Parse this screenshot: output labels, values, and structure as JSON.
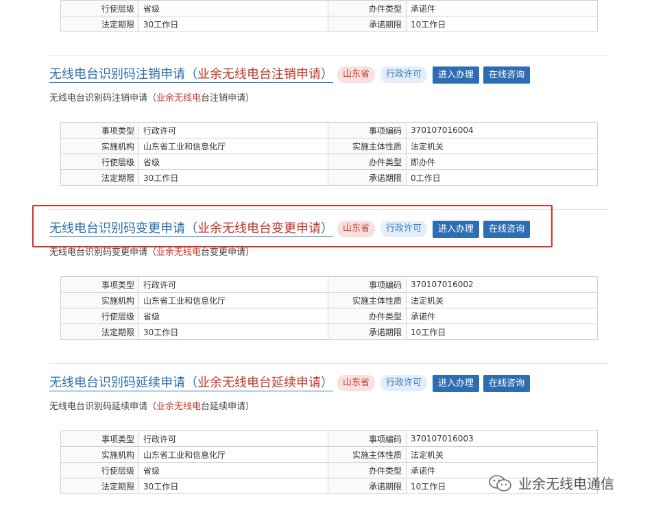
{
  "tags": {
    "region": "山东省",
    "type": "行政许可"
  },
  "buttons": {
    "enter": "进入办理",
    "consult": "在线咨询"
  },
  "labels": {
    "item_type": "事项类型",
    "item_code": "事项编码",
    "agency": "实施机构",
    "subject_nature": "实施主体性质",
    "level": "行使层级",
    "handling_type": "办件类型",
    "legal_deadline": "法定期限",
    "promised_deadline": "承诺期限"
  },
  "top_partial": {
    "level": "省级",
    "handling_type": "承诺件",
    "legal_deadline": "30工作日",
    "promised_deadline": "10工作日"
  },
  "items": [
    {
      "title_main": "无线电台识别码注销申请（",
      "title_hl": "业余无线电台注销申请",
      "title_end": "）",
      "desc_pre": "无线电台识别码注销申请（",
      "desc_hl": "业余无线电",
      "desc_post": "台注销申请）",
      "item_type": "行政许可",
      "item_code": "370107016004",
      "agency": "山东省工业和信息化厅",
      "subject_nature": "法定机关",
      "level": "省级",
      "handling_type": "即办件",
      "legal_deadline": "30工作日",
      "promised_deadline": "0工作日"
    },
    {
      "title_main": "无线电台识别码变更申请（",
      "title_hl": "业余无线电台变更申请",
      "title_end": "）",
      "desc_pre": "无线电台识别码变更申请（",
      "desc_hl": "业余无线电",
      "desc_post": "台变更申请）",
      "item_type": "行政许可",
      "item_code": "370107016002",
      "agency": "山东省工业和信息化厅",
      "subject_nature": "法定机关",
      "level": "省级",
      "handling_type": "承诺件",
      "legal_deadline": "30工作日",
      "promised_deadline": "10工作日"
    },
    {
      "title_main": "无线电台识别码延续申请（",
      "title_hl": "业余无线电台延续申请",
      "title_end": "）",
      "desc_pre": "无线电台识别码延续申请（",
      "desc_hl": "业余无线电",
      "desc_post": "台延续申请）",
      "item_type": "行政许可",
      "item_code": "370107016003",
      "agency": "山东省工业和信息化厅",
      "subject_nature": "法定机关",
      "level": "省级",
      "handling_type": "承诺件",
      "legal_deadline": "30工作日",
      "promised_deadline": "10工作日"
    }
  ],
  "watermark": {
    "text": "业余无线电通信",
    "icon": "wechat-icon"
  },
  "colors": {
    "accent": "#2f6db3",
    "highlight": "#c0392b",
    "annotation_box": "#d9302a"
  }
}
